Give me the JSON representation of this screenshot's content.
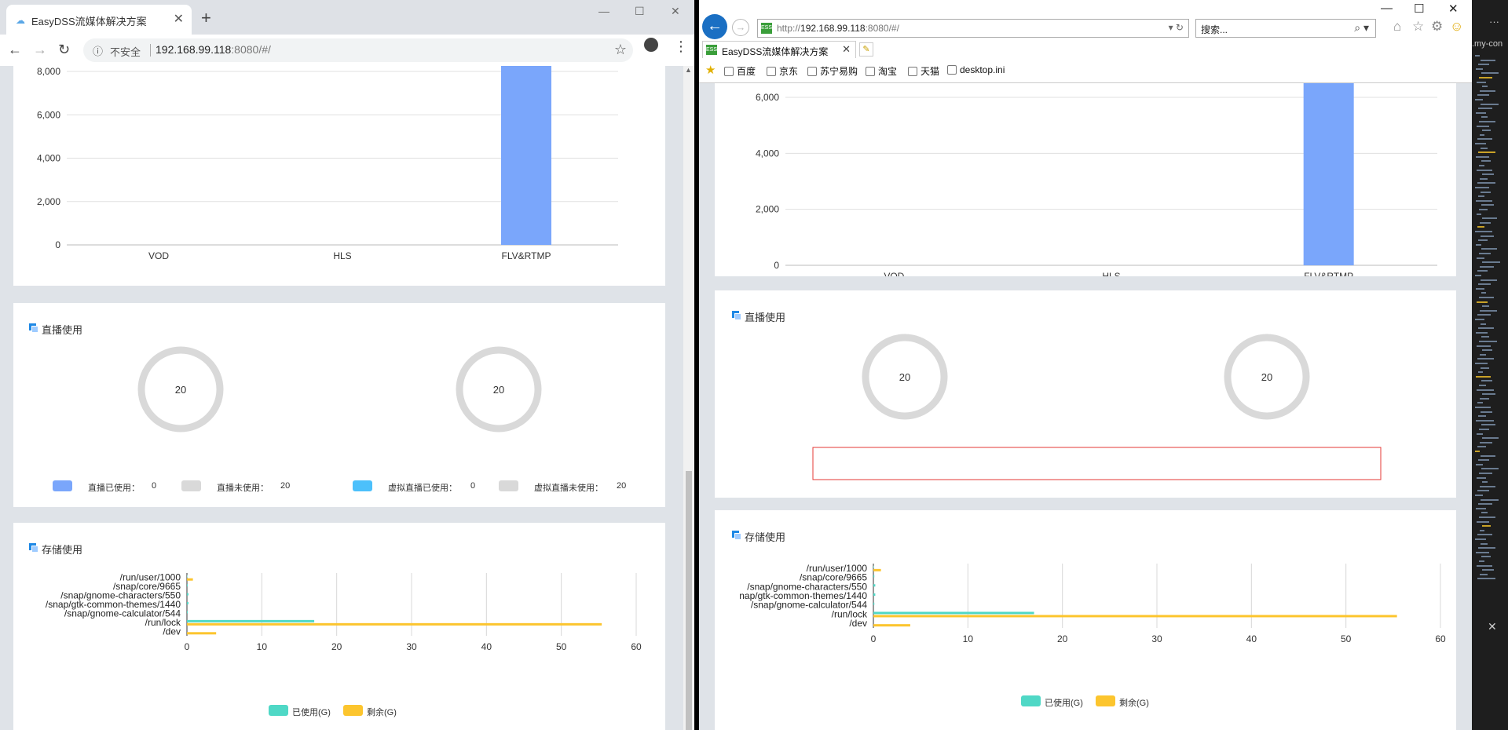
{
  "chrome": {
    "tab_title": "EasyDSS流媒体解决方案",
    "new_tab": "+",
    "win_min": "—",
    "win_max": "☐",
    "win_close": "✕",
    "back": "←",
    "forward": "→",
    "reload": "↻",
    "info_icon": "ⓘ",
    "insecure": "不安全",
    "url_host": "192.168.99.118",
    "url_rest": ":8080/#/",
    "star": "☆",
    "menu": "⋮"
  },
  "ie": {
    "back": "←",
    "forward": "→",
    "url_prefix": "http://",
    "url_host": "192.168.99.118",
    "url_rest": ":8080/#/",
    "addr_controls": "▾ ↻",
    "search_placeholder": "搜索...",
    "search_icon": "⌕ ▾",
    "tab_title": "EasyDSS流媒体解决方案",
    "tab_close": "✕",
    "win_min": "—",
    "win_max": "☐",
    "win_close": "✕",
    "home_icon": "⌂",
    "fav_icon": "☆",
    "gear_icon": "⚙",
    "smiley_icon": "☺",
    "fav_star": "★",
    "favorites": [
      "百度",
      "京东",
      "苏宁易购",
      "淘宝",
      "天猫",
      "desktop.ini"
    ]
  },
  "editor": {
    "tab_name": ".my-con",
    "dots": "···",
    "close": "✕"
  },
  "section_live": {
    "title": "直播使用"
  },
  "section_storage": {
    "title": "存储使用"
  },
  "live_legend": {
    "used_label": "直播已使用：",
    "used_value": "0",
    "unused_label": "直播未使用：",
    "unused_value": "20",
    "vused_label": "虚拟直播已使用：",
    "vused_value": "0",
    "vunused_label": "虚拟直播未使用：",
    "vunused_value": "20"
  },
  "storage_legend": {
    "used": "已使用(G)",
    "remain": "剩余(G)"
  },
  "colors": {
    "bar_blue": "#7aa6fb",
    "used_teal": "#4fd8c6",
    "remain_yellow": "#fcc52e",
    "ring_gray": "#d9d9d9",
    "legend_live_used": "#7aa6fb",
    "legend_vlive_used": "#4cc0fb"
  },
  "chart_data": [
    {
      "type": "bar",
      "title": "",
      "categories": [
        "VOD",
        "HLS",
        "FLV&RTMP"
      ],
      "values": [
        0,
        0,
        8600
      ],
      "ylim": [
        0,
        8000
      ],
      "yticks": [
        0,
        2000,
        4000,
        6000,
        8000
      ],
      "ytick_labels": [
        "0",
        "2,000",
        "4,000",
        "6,000",
        "8,000"
      ],
      "grid": true,
      "note_view": "left browser (scrolled; top cut off)"
    },
    {
      "type": "bar",
      "title": "",
      "categories": [
        "VOD",
        "HLS",
        "FLV&RTMP"
      ],
      "values": [
        0,
        0,
        6900
      ],
      "ylim": [
        0,
        6000
      ],
      "yticks": [
        0,
        2000,
        4000,
        6000
      ],
      "ytick_labels": [
        "0",
        "2,000",
        "4,000",
        "6,000"
      ],
      "grid": true
    },
    {
      "type": "pie",
      "title": "",
      "center_label": "20",
      "values": [
        0,
        20
      ],
      "labels": [
        "直播已使用",
        "直播未使用"
      ]
    },
    {
      "type": "pie",
      "title": "",
      "center_label": "20",
      "values": [
        0,
        20
      ],
      "labels": [
        "虚拟直播已使用",
        "虚拟直播未使用"
      ]
    },
    {
      "type": "bar",
      "orientation": "horizontal",
      "title": "",
      "categories": [
        "/dev",
        "/run/lock",
        "/snap/gnome-calculator/544",
        "/snap/gtk-common-themes/1440",
        "/snap/gnome-characters/550",
        "/snap/core/9665",
        "/run/user/1000"
      ],
      "categories_right_view": [
        "/dev",
        "/run/lock",
        "/snap/gnome-calculator/544",
        "nap/gtk-common-themes/1440",
        "/snap/gnome-characters/550",
        "/snap/core/9665",
        "/run/user/1000"
      ],
      "series": [
        {
          "name": "已使用(G)",
          "values": [
            0,
            17,
            0.1,
            0.2,
            0.2,
            0.1,
            0.05
          ]
        },
        {
          "name": "剩余(G)",
          "values": [
            3.9,
            55.4,
            0,
            0,
            0,
            0,
            0.8
          ]
        }
      ],
      "xlim": [
        0,
        60
      ],
      "xticks": [
        0,
        10,
        20,
        30,
        40,
        50,
        60
      ],
      "grid": true,
      "legend": "bottom"
    }
  ]
}
